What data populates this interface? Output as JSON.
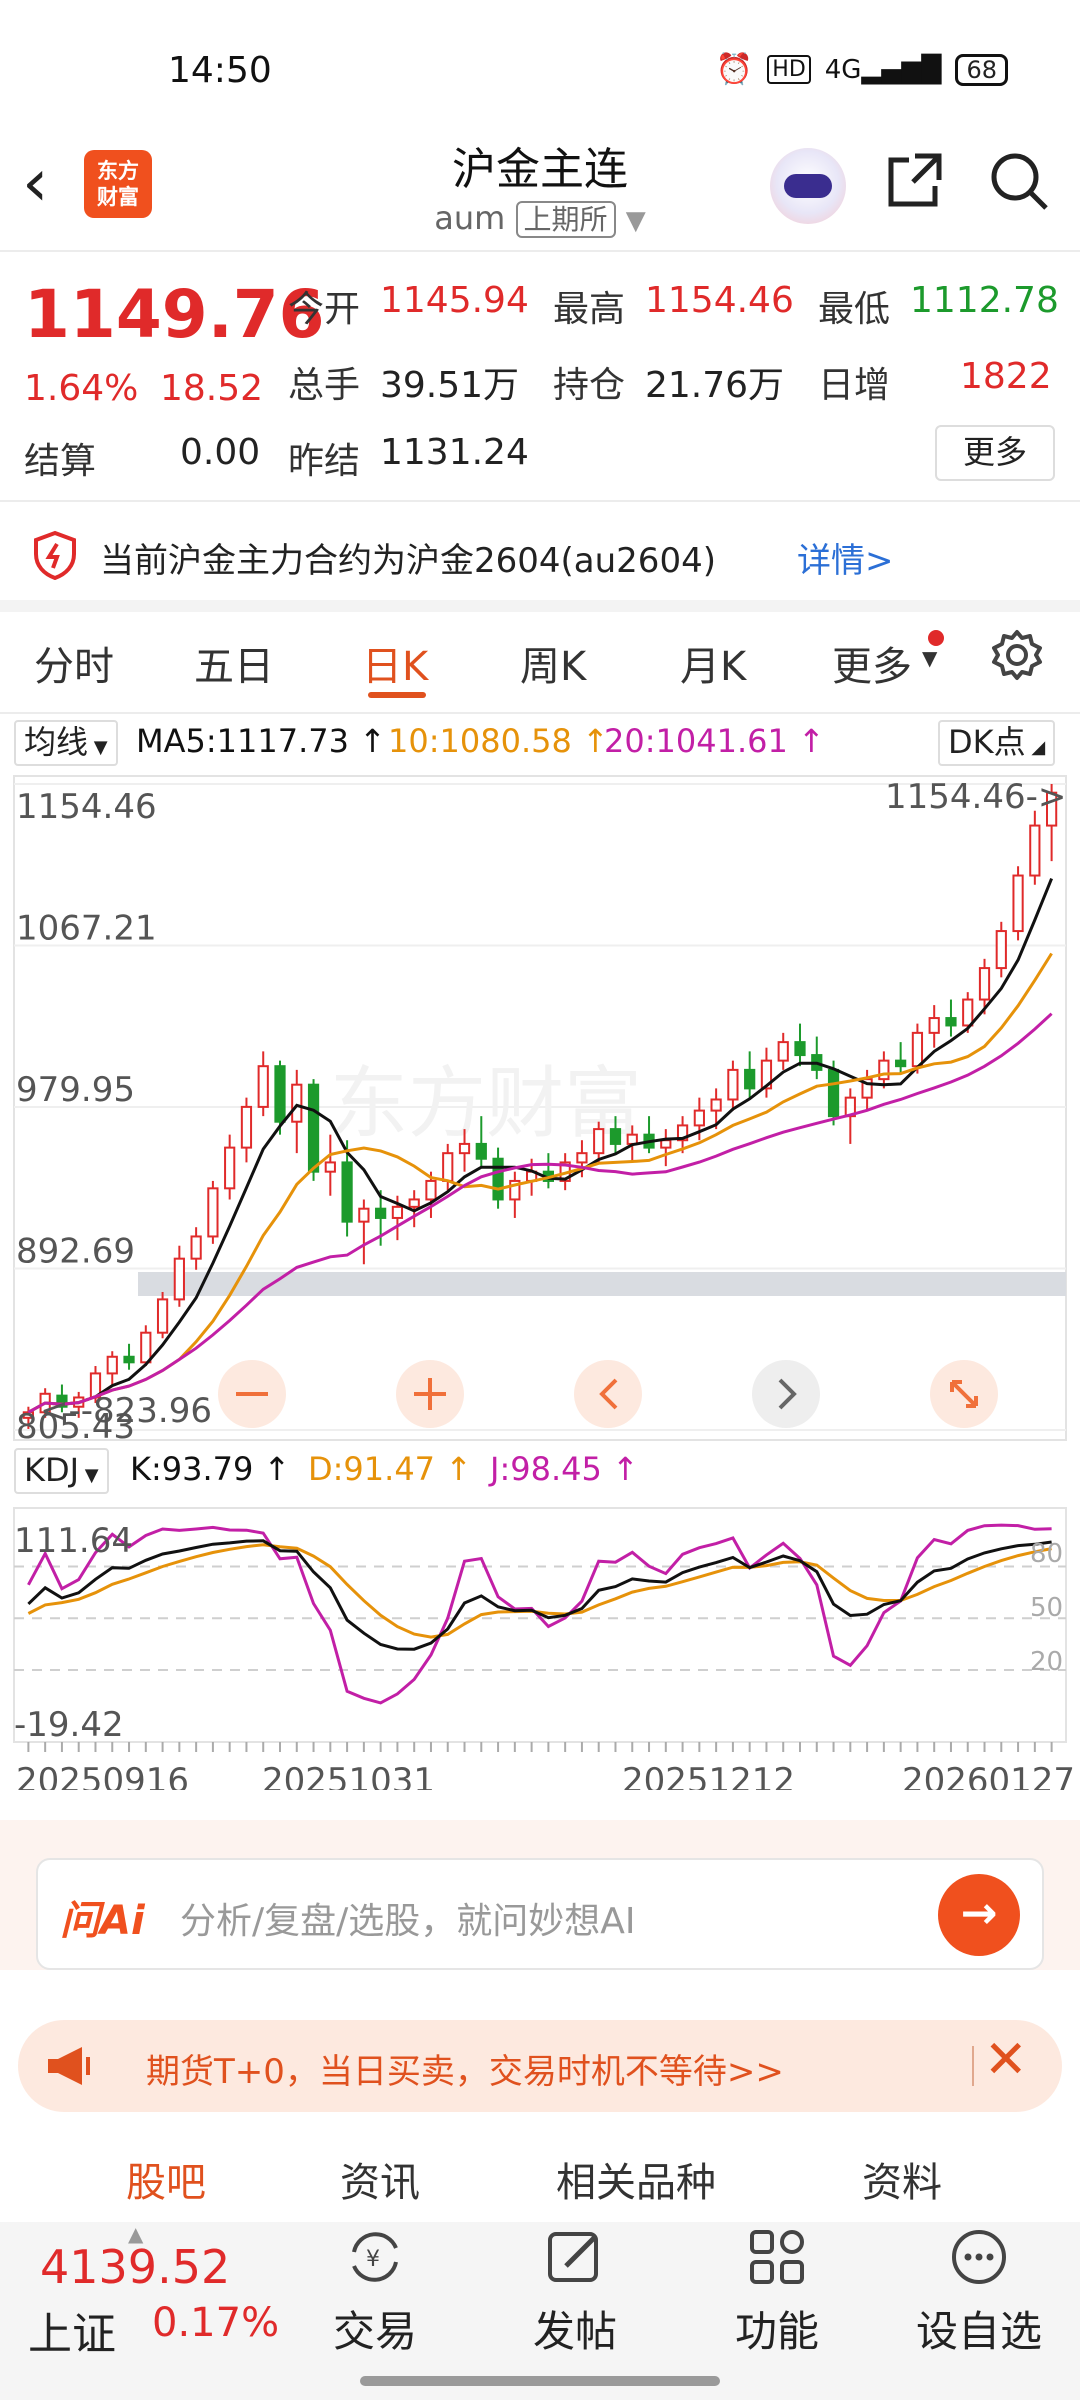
{
  "status": {
    "time": "14:50",
    "hd": "HD",
    "net": "4G",
    "battery": "68"
  },
  "header": {
    "title": "沪金主连",
    "code": "aum",
    "exchange": "上期所"
  },
  "quote": {
    "price": "1149.76",
    "pct": "1.64%",
    "change": "18.52",
    "open_label": "今开",
    "open": "1145.94",
    "high_label": "最高",
    "high": "1154.46",
    "low_label": "最低",
    "low": "1112.78",
    "volume_label": "总手",
    "volume": "39.51万",
    "oi_label": "持仓",
    "oi": "21.76万",
    "daily_inc_label": "日增",
    "daily_inc": "1822",
    "settle_label": "结算",
    "settle": "0.00",
    "prev_settle_label": "昨结",
    "prev_settle": "1131.24",
    "more_label": "更多"
  },
  "notice": {
    "text": "当前沪金主力合约为沪金2604(au2604)",
    "link": "详情>"
  },
  "tabs": [
    "分时",
    "五日",
    "日K",
    "周K",
    "月K",
    "更多"
  ],
  "active_tab": "日K",
  "ma_row": {
    "selector": "均线",
    "ma5": "MA5:1117.73",
    "ma10": "10:1080.58",
    "ma20": "20:1041.61",
    "dk": "DK点"
  },
  "kdj_row": {
    "selector": "KDJ",
    "k": "K:93.79",
    "d": "D:91.47",
    "j": "J:98.45"
  },
  "chart_labels": {
    "y_ticks": [
      "1154.46",
      "1067.21",
      "979.95",
      "892.69",
      "805.43"
    ],
    "max_marker": "1154.46->",
    "min_marker": "<--823.96",
    "kdj_ticks": [
      "111.64",
      "-19.42"
    ],
    "kdj_ref": [
      "80",
      "50",
      "20"
    ],
    "dates": [
      "20250916",
      "20251031",
      "20251212",
      "20260127"
    ],
    "watermark": "东方财富"
  },
  "colors": {
    "accent": "#e0511e",
    "up": "#e02a2a",
    "down": "#1c9a2c",
    "ma5": "#111111",
    "ma10": "#e6920a",
    "ma20": "#c21fa6"
  },
  "chart_data": {
    "type": "candlestick",
    "candles": [
      [
        812,
        818,
        806,
        815
      ],
      [
        815,
        828,
        812,
        825
      ],
      [
        824,
        830,
        815,
        818
      ],
      [
        818,
        826,
        812,
        823
      ],
      [
        823,
        840,
        820,
        836
      ],
      [
        836,
        848,
        830,
        845
      ],
      [
        845,
        852,
        838,
        842
      ],
      [
        842,
        862,
        840,
        858
      ],
      [
        858,
        880,
        855,
        876
      ],
      [
        876,
        905,
        872,
        898
      ],
      [
        898,
        915,
        892,
        910
      ],
      [
        910,
        940,
        906,
        936
      ],
      [
        936,
        965,
        930,
        958
      ],
      [
        958,
        985,
        950,
        980
      ],
      [
        980,
        1010,
        975,
        1002
      ],
      [
        1002,
        1005,
        965,
        972
      ],
      [
        972,
        1000,
        955,
        992
      ],
      [
        992,
        995,
        940,
        945
      ],
      [
        945,
        965,
        932,
        950
      ],
      [
        950,
        962,
        910,
        918
      ],
      [
        918,
        930,
        895,
        925
      ],
      [
        925,
        935,
        905,
        920
      ],
      [
        920,
        932,
        908,
        926
      ],
      [
        926,
        935,
        915,
        930
      ],
      [
        930,
        945,
        920,
        940
      ],
      [
        940,
        960,
        935,
        955
      ],
      [
        955,
        968,
        945,
        960
      ],
      [
        960,
        975,
        948,
        952
      ],
      [
        952,
        958,
        925,
        930
      ],
      [
        930,
        945,
        920,
        940
      ],
      [
        940,
        952,
        932,
        945
      ],
      [
        945,
        955,
        936,
        940
      ],
      [
        940,
        955,
        935,
        950
      ],
      [
        950,
        962,
        942,
        955
      ],
      [
        955,
        972,
        950,
        968
      ],
      [
        968,
        975,
        955,
        960
      ],
      [
        960,
        970,
        950,
        965
      ],
      [
        965,
        975,
        955,
        958
      ],
      [
        958,
        968,
        948,
        962
      ],
      [
        962,
        975,
        955,
        970
      ],
      [
        970,
        985,
        962,
        978
      ],
      [
        978,
        990,
        968,
        984
      ],
      [
        984,
        1005,
        978,
        1000
      ],
      [
        1000,
        1010,
        985,
        990
      ],
      [
        990,
        1012,
        985,
        1005
      ],
      [
        1005,
        1020,
        1000,
        1015
      ],
      [
        1015,
        1025,
        1002,
        1008
      ],
      [
        1008,
        1018,
        995,
        1000
      ],
      [
        1000,
        1005,
        970,
        975
      ],
      [
        975,
        990,
        960,
        985
      ],
      [
        985,
        1000,
        978,
        995
      ],
      [
        995,
        1010,
        990,
        1005
      ],
      [
        1005,
        1015,
        998,
        1002
      ],
      [
        1002,
        1025,
        998,
        1020
      ],
      [
        1020,
        1035,
        1012,
        1028
      ],
      [
        1028,
        1038,
        1018,
        1024
      ],
      [
        1024,
        1042,
        1020,
        1038
      ],
      [
        1038,
        1060,
        1030,
        1055
      ],
      [
        1055,
        1080,
        1050,
        1075
      ],
      [
        1075,
        1110,
        1070,
        1105
      ],
      [
        1105,
        1140,
        1100,
        1132
      ],
      [
        1132,
        1154.46,
        1112.78,
        1149.76
      ]
    ],
    "ma5_last": 1117.73,
    "ma10_last": 1080.58,
    "ma20_last": 1041.61,
    "kdj_last": {
      "K": 93.79,
      "D": 91.47,
      "J": 98.45
    },
    "ylim": [
      805.43,
      1154.46
    ],
    "kdj_ylim": [
      -19.42,
      111.64
    ]
  },
  "ai": {
    "logo": "问Ai",
    "placeholder": "分析/复盘/选股，就问妙想AI"
  },
  "promo": {
    "text": "期货T+0，当日买卖，交易时机不等待>>"
  },
  "bottom_tabs": [
    "股吧",
    "资讯",
    "相关品种",
    "资料"
  ],
  "index": {
    "value": "4139.52",
    "name": "上证",
    "pct": "0.17%"
  },
  "nav": [
    "交易",
    "发帖",
    "功能",
    "设自选"
  ]
}
